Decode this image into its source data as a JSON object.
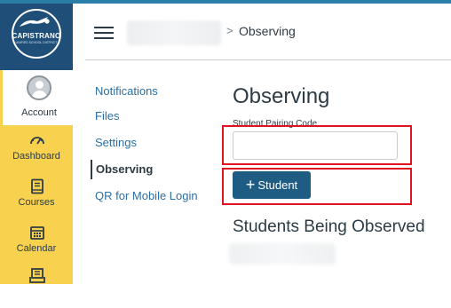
{
  "global_nav": {
    "logo": {
      "name": "CAPISTRANO",
      "subtitle": "UNIFIED SCHOOL DISTRICT"
    },
    "items": [
      {
        "label": "Account",
        "icon": "avatar-icon",
        "active": true
      },
      {
        "label": "Dashboard",
        "icon": "dashboard-icon"
      },
      {
        "label": "Courses",
        "icon": "book-icon"
      },
      {
        "label": "Calendar",
        "icon": "calendar-icon"
      },
      {
        "label": "",
        "icon": "inbox-icon"
      }
    ],
    "background_color": "#f8d24e"
  },
  "header": {
    "breadcrumb_separator": ">",
    "breadcrumb_current": "Observing"
  },
  "sub_nav": {
    "items": [
      {
        "label": "Notifications"
      },
      {
        "label": "Files"
      },
      {
        "label": "Settings"
      },
      {
        "label": "Observing",
        "active": true
      },
      {
        "label": "QR for Mobile Login"
      }
    ]
  },
  "main": {
    "title": "Observing",
    "pairing_code": {
      "label": "Student Pairing Code",
      "value": "",
      "placeholder": ""
    },
    "add_student_button": {
      "icon": "plus-icon",
      "label": "Student"
    },
    "observed_section_title": "Students Being Observed"
  },
  "colors": {
    "accent_button": "#1e5c83",
    "link": "#2b6fa3",
    "highlight": "#e0121f"
  }
}
